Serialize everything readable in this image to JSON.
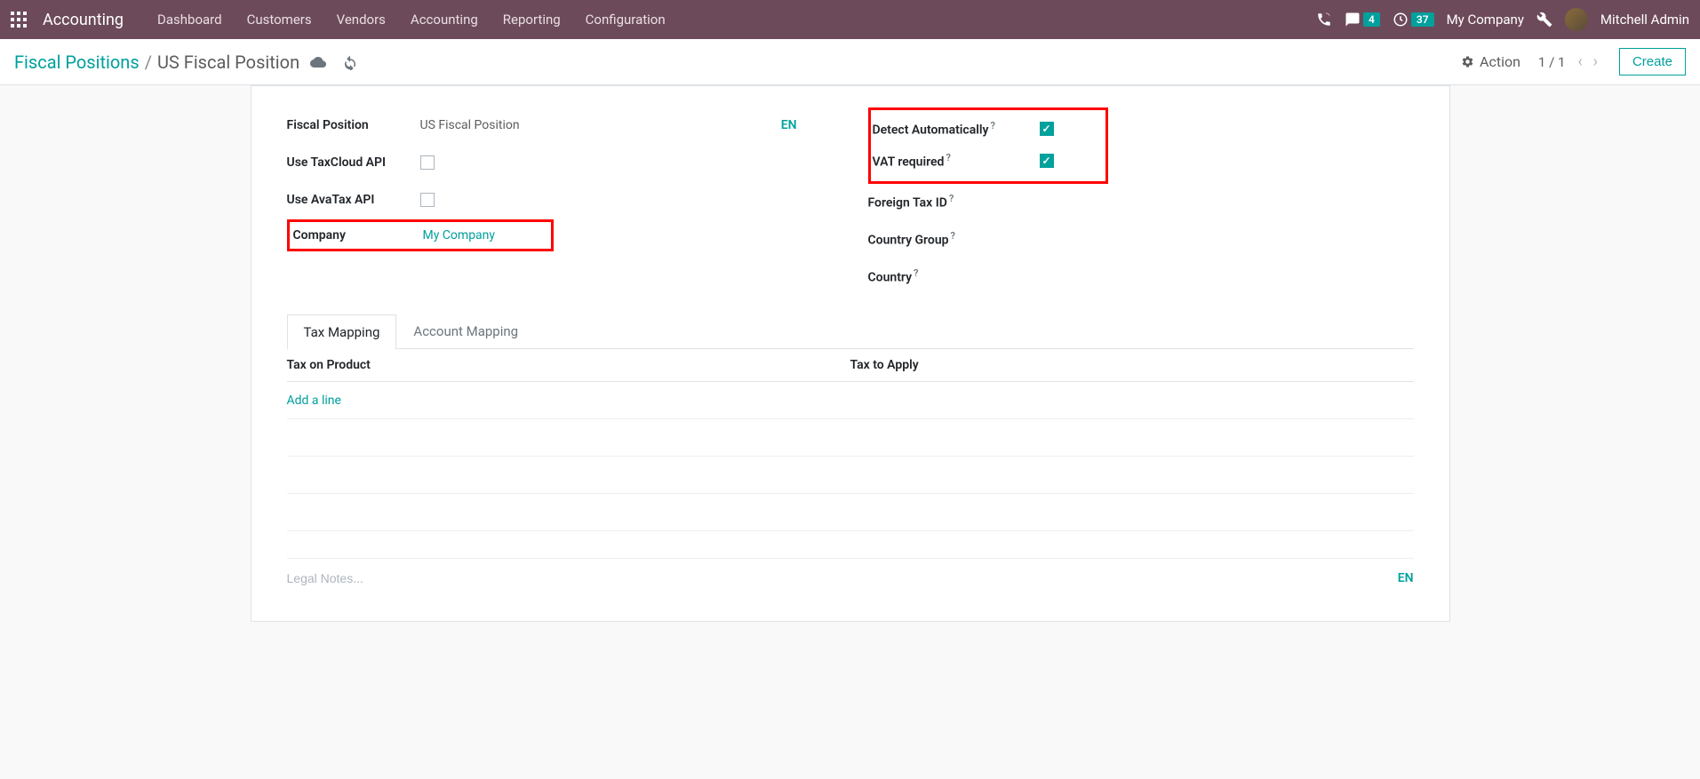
{
  "navbar": {
    "app_name": "Accounting",
    "menu": [
      "Dashboard",
      "Customers",
      "Vendors",
      "Accounting",
      "Reporting",
      "Configuration"
    ],
    "messages_badge": "4",
    "activities_badge": "37",
    "company": "My Company",
    "user": "Mitchell Admin"
  },
  "control_panel": {
    "breadcrumb_parent": "Fiscal Positions",
    "breadcrumb_current": "US Fiscal Position",
    "action_label": "Action",
    "pager": "1 / 1",
    "create_label": "Create"
  },
  "form": {
    "left": {
      "fiscal_position_label": "Fiscal Position",
      "fiscal_position_value": "US Fiscal Position",
      "lang": "EN",
      "use_taxcloud_label": "Use TaxCloud API",
      "use_avatax_label": "Use AvaTax API",
      "company_label": "Company",
      "company_value": "My Company"
    },
    "right": {
      "detect_auto_label": "Detect Automatically",
      "vat_required_label": "VAT required",
      "foreign_tax_label": "Foreign Tax ID",
      "country_group_label": "Country Group",
      "country_label": "Country"
    },
    "tabs": {
      "tax_mapping": "Tax Mapping",
      "account_mapping": "Account Mapping"
    },
    "table": {
      "col1": "Tax on Product",
      "col2": "Tax to Apply",
      "add_line": "Add a line"
    },
    "notes_placeholder": "Legal Notes...",
    "notes_lang": "EN"
  }
}
